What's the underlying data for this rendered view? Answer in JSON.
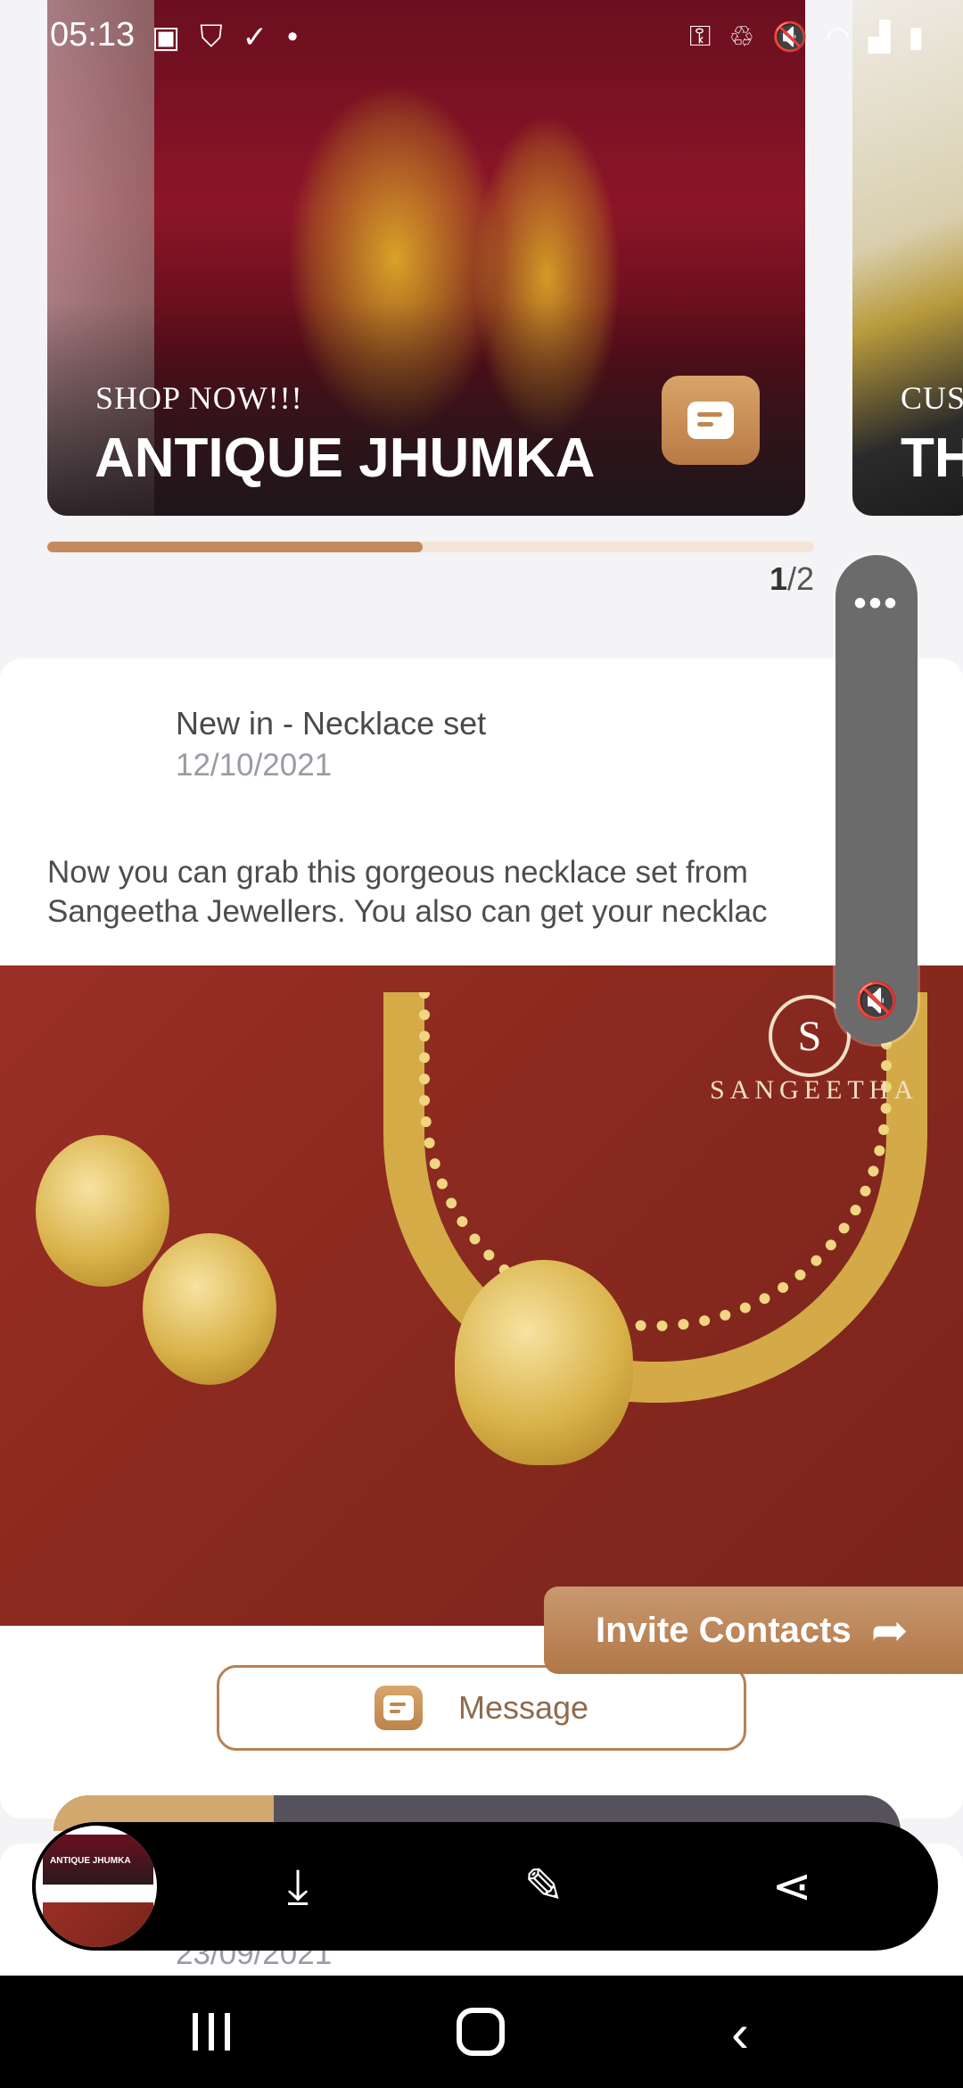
{
  "status_bar": {
    "time": "05:13",
    "left_icons": [
      "gallery-icon",
      "shield-icon",
      "check-icon",
      "dot-icon"
    ],
    "right_icons": [
      "key-icon",
      "battery-saver-icon",
      "mute-icon",
      "wifi-icon",
      "signal-icon",
      "battery-icon"
    ]
  },
  "carousel": {
    "cards": [
      {
        "subtitle": "SHOP NOW!!!",
        "title": "ANTIQUE JHUMKA"
      },
      {
        "subtitle": "CUS",
        "title": "TH"
      }
    ],
    "progress": 0.49,
    "pager_current": "1",
    "pager_total": "/2"
  },
  "side_panel": {
    "more": "•••",
    "mute": "🔇"
  },
  "post": {
    "title": "New in - Necklace set",
    "date": "12/10/2021",
    "body_line1": "Now you can grab this gorgeous necklace set from",
    "body_line2": "Sangeetha Jewellers. You also can get your necklac",
    "image_logo_letter": "S",
    "image_logo_text": "SANGEETHA",
    "message_label": "Message"
  },
  "invite": {
    "label": "Invite Contacts",
    "icon": "share-arrow-icon"
  },
  "video_progress": 0.26,
  "post2": {
    "date": "23/09/2021"
  },
  "screenshot_toolbar": {
    "thumb_title": "ANTIQUE JHUMKA",
    "tools": [
      "scroll-capture-icon",
      "crop-edit-icon",
      "share-icon"
    ]
  },
  "colors": {
    "accent": "#c38a5d",
    "button_brown": "#b07746",
    "progress_track": "#f3e6d8"
  }
}
